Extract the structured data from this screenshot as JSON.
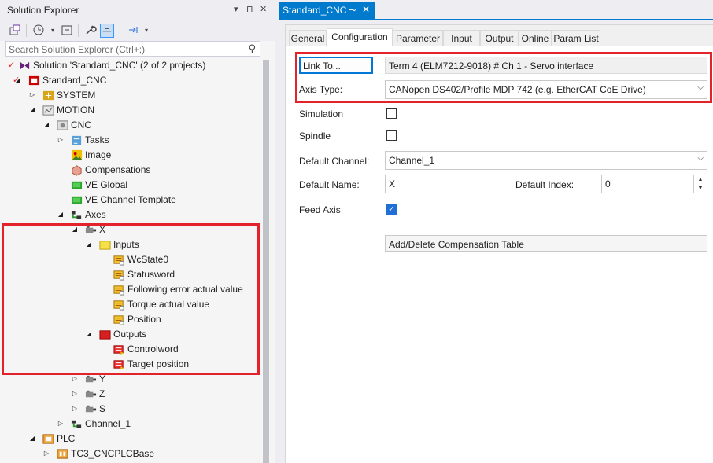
{
  "solution_explorer": {
    "title": "Solution Explorer",
    "title_buttons": {
      "dropdown": "▾",
      "pin": "⊓",
      "close": "✕"
    },
    "search_placeholder": "Search Solution Explorer (Ctrl+;)",
    "tree": [
      {
        "label": "Solution 'Standard_CNC' (2 of 2 projects)",
        "icon": "solution-icon",
        "level": 0,
        "expander": ""
      },
      {
        "label": "Standard_CNC",
        "icon": "twincat-project-icon",
        "level": 0,
        "expander": "expanded"
      },
      {
        "label": "SYSTEM",
        "icon": "system-icon",
        "level": 1,
        "expander": "collapsed"
      },
      {
        "label": "MOTION",
        "icon": "motion-icon",
        "level": 1,
        "expander": "expanded"
      },
      {
        "label": "CNC",
        "icon": "cnc-icon",
        "level": 2,
        "expander": "expanded"
      },
      {
        "label": "Tasks",
        "icon": "tasks-icon",
        "level": 3,
        "expander": "collapsed"
      },
      {
        "label": "Image",
        "icon": "image-icon",
        "level": 3,
        "expander": ""
      },
      {
        "label": "Compensations",
        "icon": "compensations-icon",
        "level": 3,
        "expander": ""
      },
      {
        "label": "VE Global",
        "icon": "ve-global-icon",
        "level": 3,
        "expander": ""
      },
      {
        "label": "VE Channel Template",
        "icon": "ve-channel-icon",
        "level": 3,
        "expander": ""
      },
      {
        "label": "Axes",
        "icon": "axes-icon",
        "level": 3,
        "expander": "expanded"
      },
      {
        "label": "X",
        "icon": "axis-icon",
        "level": 4,
        "expander": "expanded"
      },
      {
        "label": "Inputs",
        "icon": "inputs-folder-icon",
        "level": 5,
        "expander": "expanded"
      },
      {
        "label": "WcState0",
        "icon": "input-var-icon",
        "level": 6,
        "expander": ""
      },
      {
        "label": "Statusword",
        "icon": "input-var-icon",
        "level": 6,
        "expander": ""
      },
      {
        "label": "Following error actual value",
        "icon": "input-var-icon",
        "level": 6,
        "expander": ""
      },
      {
        "label": "Torque actual value",
        "icon": "input-var-icon",
        "level": 6,
        "expander": ""
      },
      {
        "label": "Position",
        "icon": "input-var-icon",
        "level": 6,
        "expander": ""
      },
      {
        "label": "Outputs",
        "icon": "outputs-folder-icon",
        "level": 5,
        "expander": "expanded"
      },
      {
        "label": "Controlword",
        "icon": "output-var-icon",
        "level": 6,
        "expander": ""
      },
      {
        "label": "Target position",
        "icon": "output-var-icon",
        "level": 6,
        "expander": ""
      },
      {
        "label": "Y",
        "icon": "axis-icon",
        "level": 4,
        "expander": "collapsed"
      },
      {
        "label": "Z",
        "icon": "axis-icon",
        "level": 4,
        "expander": "collapsed"
      },
      {
        "label": "S",
        "icon": "axis-icon",
        "level": 4,
        "expander": "collapsed"
      },
      {
        "label": "Channel_1",
        "icon": "channel-icon",
        "level": 3,
        "expander": "collapsed"
      },
      {
        "label": "PLC",
        "icon": "plc-icon",
        "level": 1,
        "expander": "expanded"
      },
      {
        "label": "TC3_CNCPLCBase",
        "icon": "plc-project-icon",
        "level": 2,
        "expander": "collapsed"
      }
    ]
  },
  "document": {
    "tab_title": "Standard_CNC",
    "pin_glyph": "⊸",
    "close_glyph": "✕",
    "tabs": [
      "General",
      "Configuration",
      "Parameter",
      "Input",
      "Output",
      "Online",
      "Param List"
    ],
    "active_tab": "Configuration",
    "form": {
      "link_button": "Link To...",
      "link_value": "Term 4 (ELM7212-9018) # Ch 1 - Servo interface",
      "axis_type_label": "Axis Type:",
      "axis_type_value": "CANopen DS402/Profile MDP 742 (e.g. EtherCAT CoE Drive)",
      "simulation_label": "Simulation",
      "simulation_checked": false,
      "spindle_label": "Spindle",
      "spindle_checked": false,
      "default_channel_label": "Default Channel:",
      "default_channel_value": "Channel_1",
      "default_name_label": "Default Name:",
      "default_name_value": "X",
      "default_index_label": "Default Index:",
      "default_index_value": "0",
      "feed_axis_label": "Feed Axis",
      "feed_axis_checked": true,
      "compensation_button": "Add/Delete Compensation Table"
    }
  },
  "colors": {
    "accent": "#007acc",
    "highlight_box": "#e3232c",
    "checkbox_checked": "#1f6fd6"
  }
}
